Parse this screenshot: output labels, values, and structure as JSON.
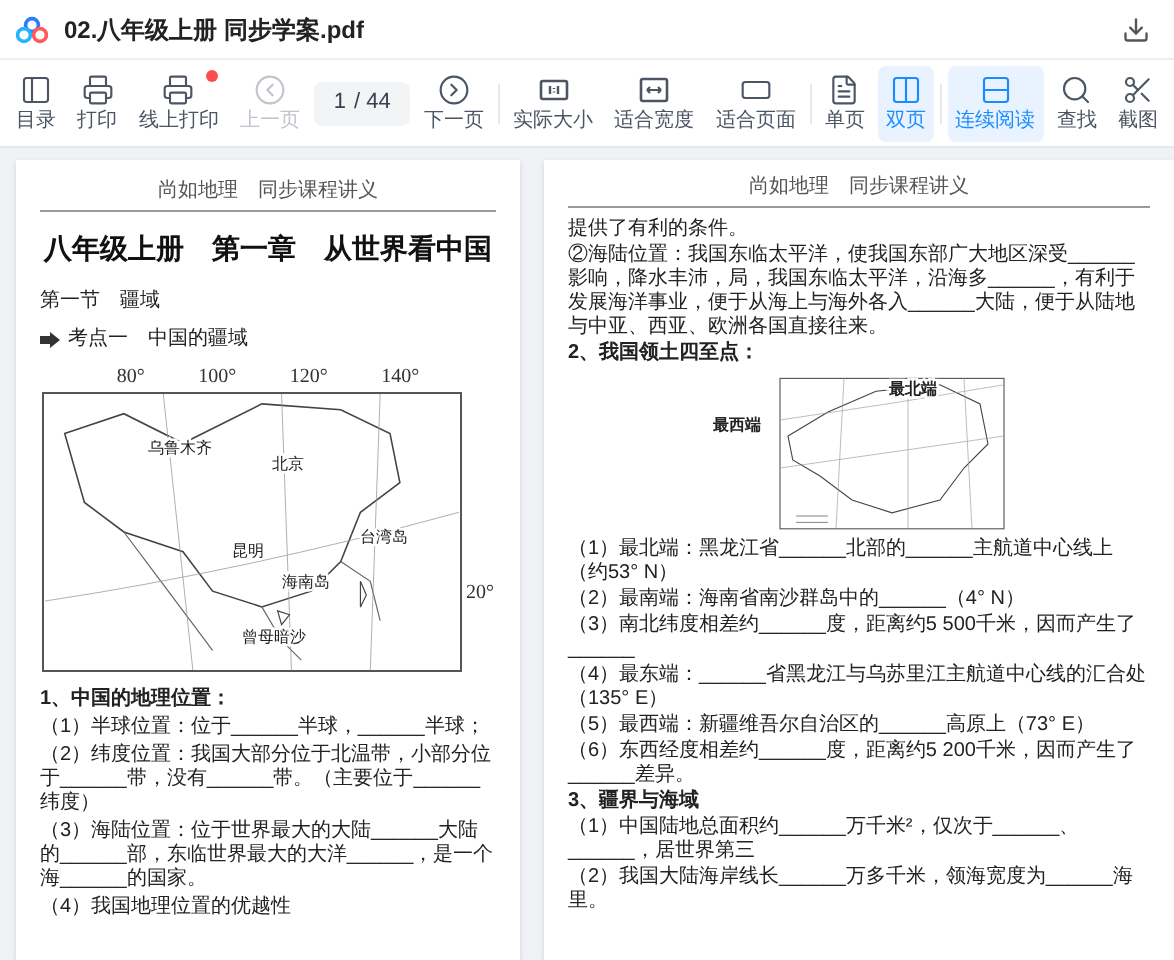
{
  "title_bar": {
    "file_name": "02.八年级上册 同步学案.pdf"
  },
  "toolbar": [
    {
      "kind": "button",
      "label": "目录",
      "selected": false,
      "disabled": false,
      "badge": false
    },
    {
      "kind": "button",
      "label": "打印",
      "selected": false,
      "disabled": false,
      "badge": false
    },
    {
      "kind": "button",
      "label": "线上打印",
      "selected": false,
      "disabled": false,
      "badge": true
    },
    {
      "kind": "button",
      "label": "上一页",
      "selected": false,
      "disabled": true,
      "badge": false
    },
    {
      "kind": "page_field",
      "value": "1",
      "total": "/ 44"
    },
    {
      "kind": "button",
      "label": "下一页",
      "selected": false,
      "disabled": false,
      "badge": false
    },
    {
      "kind": "separator"
    },
    {
      "kind": "button",
      "label": "实际大小",
      "selected": false,
      "disabled": false,
      "badge": false
    },
    {
      "kind": "button",
      "label": "适合宽度",
      "selected": false,
      "disabled": false,
      "badge": false
    },
    {
      "kind": "button",
      "label": "适合页面",
      "selected": false,
      "disabled": false,
      "badge": false
    },
    {
      "kind": "separator"
    },
    {
      "kind": "button",
      "label": "单页",
      "selected": false,
      "disabled": false,
      "badge": false
    },
    {
      "kind": "button",
      "label": "双页",
      "selected": true,
      "disabled": false,
      "badge": false
    },
    {
      "kind": "separator"
    },
    {
      "kind": "button",
      "label": "连续阅读",
      "selected": true,
      "disabled": false,
      "badge": false
    },
    {
      "kind": "button",
      "label": "查找",
      "selected": false,
      "disabled": false,
      "badge": false
    },
    {
      "kind": "button",
      "label": "截图",
      "selected": false,
      "disabled": false,
      "badge": false
    }
  ],
  "left_page": {
    "header": "尚如地理　同步课程讲义",
    "title": "八年级上册　第一章　从世界看中国",
    "section": "第一节　疆域",
    "point": "考点一　中国的疆域",
    "map": {
      "top_ticks": [
        "80°",
        "100°",
        "120°",
        "140°"
      ],
      "side_tick": "20°",
      "labels": [
        "乌鲁木齐",
        "北京",
        "台湾岛",
        "昆明",
        "海南岛",
        "曾母暗沙"
      ]
    },
    "lines": [
      {
        "kind": "heading",
        "text": "1、中国的地理位置："
      },
      {
        "kind": "item",
        "text": "（1）半球位置：位于______半球，______半球；"
      },
      {
        "kind": "item",
        "text": "（2）纬度位置：我国大部分位于北温带，小部分位于______带，没有______带。（主要位于______纬度）"
      },
      {
        "kind": "item",
        "text": "（3）海陆位置：位于世界最大的大陆______大陆的______部，东临世界最大的大洋______，是一个海______的国家。"
      },
      {
        "kind": "item",
        "text": "（4）我国地理位置的优越性"
      }
    ]
  },
  "right_page": {
    "header": "尚如地理　同步课程讲义",
    "lines_before": [
      {
        "kind": "item",
        "text": "提供了有利的条件。"
      },
      {
        "kind": "item",
        "text": "②海陆位置：我国东临太平洋，使我国东部广大地区深受______影响，降水丰沛，局，我国东临太平洋，沿海多______，有利于发展海洋事业，便于从海上与海外各入______大陆，便于从陆地与中亚、西亚、欧洲各国直接往来。"
      },
      {
        "kind": "heading",
        "text": "2、我国领土四至点："
      }
    ],
    "map": {
      "labels": [
        "最北端",
        "最西端"
      ]
    },
    "lines_after": [
      {
        "kind": "item",
        "text": "（1）最北端：黑龙江省______北部的______主航道中心线上（约53° N）"
      },
      {
        "kind": "item",
        "text": "（2）最南端：海南省南沙群岛中的______（4° N）"
      },
      {
        "kind": "item",
        "text": "（3）南北纬度相差约______度，距离约5 500千米，因而产生了______"
      },
      {
        "kind": "item",
        "text": "（4）最东端：______省黑龙江与乌苏里江主航道中心线的汇合处（135° E）"
      },
      {
        "kind": "item",
        "text": "（5）最西端：新疆维吾尔自治区的______高原上（73° E）"
      },
      {
        "kind": "item",
        "text": "（6）东西经度相差约______度，距离约5 200千米，因而产生了______差异。"
      },
      {
        "kind": "heading",
        "text": "3、疆界与海域"
      },
      {
        "kind": "item",
        "text": "（1）中国陆地总面积约______万千米²，仅次于______、______，居世界第三"
      },
      {
        "kind": "item",
        "text": "（2）我国大陆海岸线长______万多千米，领海宽度为______海里。"
      }
    ]
  }
}
